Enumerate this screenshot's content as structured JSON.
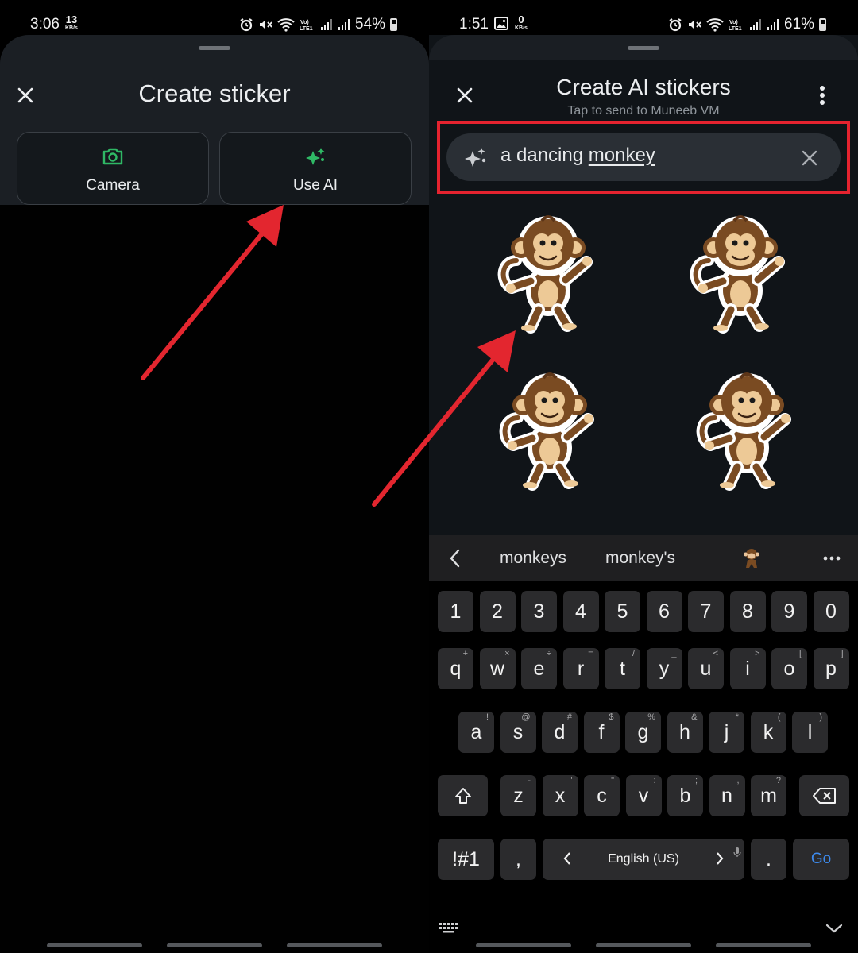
{
  "left": {
    "status": {
      "time": "3:06",
      "net_value": "13",
      "net_unit": "KB/s",
      "battery": "54%"
    },
    "title": "Create sticker",
    "options": [
      {
        "label": "Camera",
        "icon": "camera-icon"
      },
      {
        "label": "Use AI",
        "icon": "ai-sparkle-icon"
      }
    ]
  },
  "right": {
    "status": {
      "time": "1:51",
      "net_value": "0",
      "net_unit": "KB/s",
      "battery": "61%"
    },
    "title": "Create AI stickers",
    "subtitle": "Tap to send to Muneeb VM",
    "search": {
      "prefix": "a dancing ",
      "underlined": "monkey"
    },
    "stickers_count": 4
  },
  "keyboard": {
    "suggestions": [
      "monkeys",
      "monkey's"
    ],
    "numbers": [
      "1",
      "2",
      "3",
      "4",
      "5",
      "6",
      "7",
      "8",
      "9",
      "0"
    ],
    "row1": [
      {
        "k": "q",
        "h": "+"
      },
      {
        "k": "w",
        "h": "×"
      },
      {
        "k": "e",
        "h": "÷"
      },
      {
        "k": "r",
        "h": "="
      },
      {
        "k": "t",
        "h": "/"
      },
      {
        "k": "y",
        "h": "_"
      },
      {
        "k": "u",
        "h": "<"
      },
      {
        "k": "i",
        "h": ">"
      },
      {
        "k": "o",
        "h": "["
      },
      {
        "k": "p",
        "h": "]"
      }
    ],
    "row2": [
      {
        "k": "a",
        "h": "!"
      },
      {
        "k": "s",
        "h": "@"
      },
      {
        "k": "d",
        "h": "#"
      },
      {
        "k": "f",
        "h": "$"
      },
      {
        "k": "g",
        "h": "%"
      },
      {
        "k": "h",
        "h": "&"
      },
      {
        "k": "j",
        "h": "*"
      },
      {
        "k": "k",
        "h": "("
      },
      {
        "k": "l",
        "h": ")"
      }
    ],
    "row3": [
      {
        "k": "z",
        "h": "-"
      },
      {
        "k": "x",
        "h": "'"
      },
      {
        "k": "c",
        "h": "\""
      },
      {
        "k": "v",
        "h": ":"
      },
      {
        "k": "b",
        "h": ";"
      },
      {
        "k": "n",
        "h": ","
      },
      {
        "k": "m",
        "h": "?"
      }
    ],
    "symbols_label": "!#1",
    "comma": ",",
    "language": "English (US)",
    "period": ".",
    "go_label": "Go"
  },
  "colors": {
    "highlight_red": "#e5232f",
    "arrow_red": "#e3262f",
    "camera_green": "#2fb865",
    "go_blue": "#3d8bef"
  }
}
